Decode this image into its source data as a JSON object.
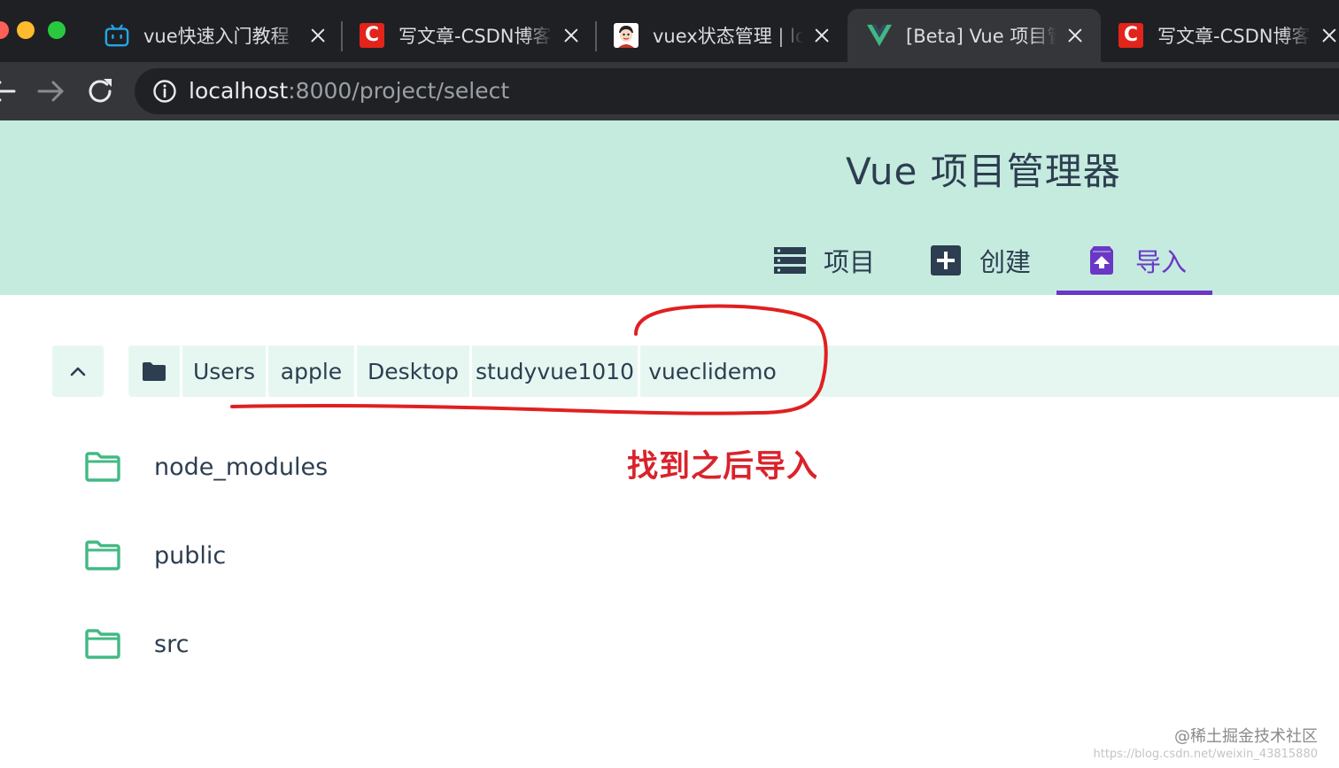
{
  "browser": {
    "tabs": [
      {
        "title": "vue快速入门教程",
        "favicon": "bilibili-tv-icon",
        "active": false
      },
      {
        "title": "写文章-CSDN博客",
        "favicon": "csdn-logo-icon",
        "active": false
      },
      {
        "title": "vuex状态管理 | lo",
        "favicon": "avatar-face-icon",
        "active": false
      },
      {
        "title": "[Beta] Vue 项目管",
        "favicon": "vue-logo-icon",
        "active": true
      },
      {
        "title": "写文章-CSDN博客",
        "favicon": "csdn-logo-icon",
        "active": false
      }
    ],
    "csdn_glyph": "C",
    "url_host": "localhost",
    "url_rest": ":8000/project/select"
  },
  "app": {
    "title": "Vue 项目管理器",
    "nav": [
      {
        "label": "项目",
        "icon": "list-icon",
        "active": false
      },
      {
        "label": "创建",
        "icon": "add-box-icon",
        "active": false
      },
      {
        "label": "导入",
        "icon": "unarchive-icon",
        "active": true
      }
    ],
    "breadcrumb": [
      "Users",
      "apple",
      "Desktop",
      "studyvue1010",
      "vueclidemo"
    ],
    "folders": [
      "node_modules",
      "public",
      "src"
    ]
  },
  "annotation": {
    "text": "找到之后导入"
  },
  "watermark": {
    "main": "@稀土掘金技术社区",
    "sub": "https://blog.csdn.net/weixin_43815880"
  },
  "colors": {
    "chrome_dark": "#1f2023",
    "chrome_toolbar": "#35363a",
    "header_bg": "#c5ebdf",
    "pathbar_bg": "#e6f7f1",
    "accent_purple": "#6a37c6",
    "text_dark": "#2c3e50",
    "folder_green": "#42b983",
    "annotation_red": "#d9232b"
  }
}
